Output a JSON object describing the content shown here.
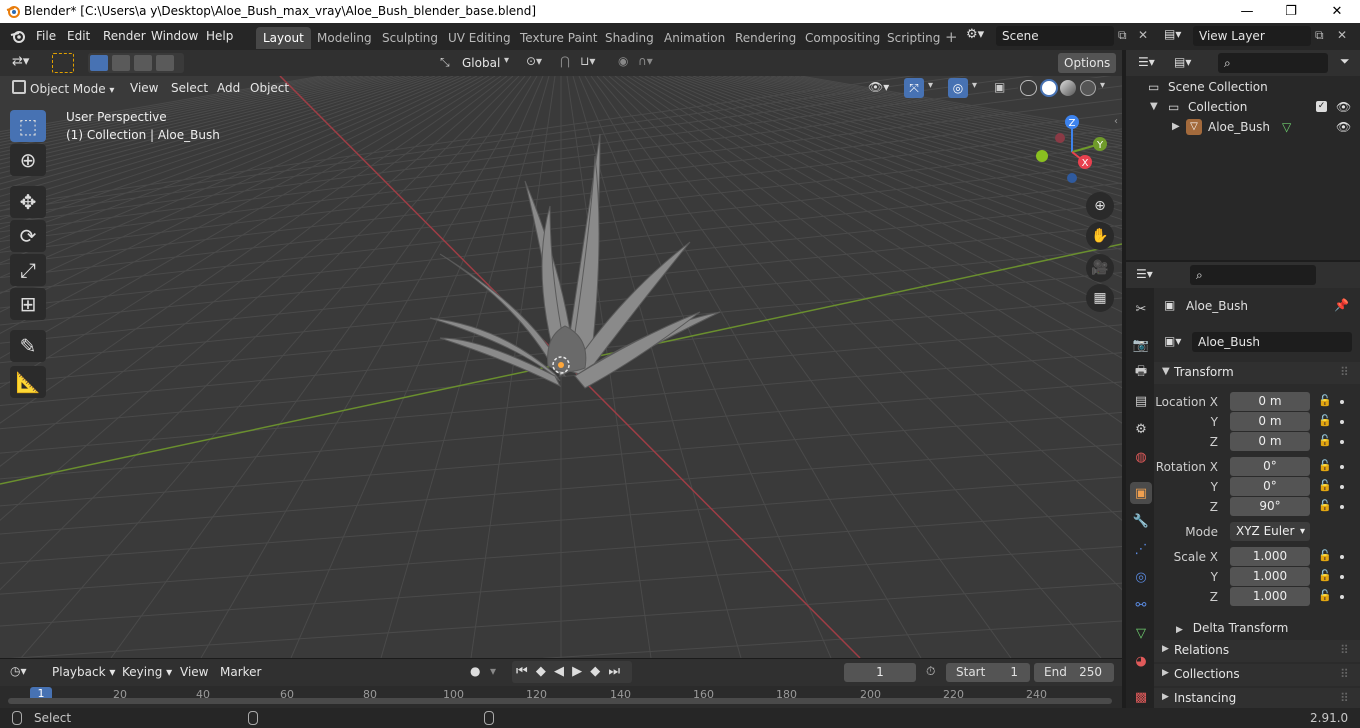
{
  "window": {
    "title": "Blender* [C:\\Users\\a y\\Desktop\\Aloe_Bush_max_vray\\Aloe_Bush_blender_base.blend]",
    "minimize": "—",
    "maximize": "❐",
    "close": "✕"
  },
  "menu": [
    "File",
    "Edit",
    "Render",
    "Window",
    "Help"
  ],
  "workspaces": [
    "Layout",
    "Modeling",
    "Sculpting",
    "UV Editing",
    "Texture Paint",
    "Shading",
    "Animation",
    "Rendering",
    "Compositing",
    "Scripting"
  ],
  "active_workspace": "Layout",
  "scene": {
    "name": "Scene"
  },
  "view_layer": {
    "name": "View Layer"
  },
  "tool_header": {
    "orientation": "Global",
    "options": "Options"
  },
  "viewport_header": {
    "mode": "Object Mode",
    "menus": [
      "View",
      "Select",
      "Add",
      "Object"
    ]
  },
  "viewport": {
    "perspective": "User Perspective",
    "collection_info": "(1) Collection | Aloe_Bush",
    "gizmo": {
      "x": "X",
      "y": "Y",
      "z": "Z"
    }
  },
  "timeline": {
    "menus": [
      "Playback",
      "Keying",
      "View",
      "Marker"
    ],
    "current_frame": "1",
    "start_label": "Start",
    "start": "1",
    "end_label": "End",
    "end": "250",
    "ticks": [
      "1",
      "20",
      "40",
      "60",
      "80",
      "100",
      "120",
      "140",
      "160",
      "180",
      "200",
      "220",
      "240"
    ]
  },
  "status": {
    "left": "Select",
    "version": "2.91.0"
  },
  "outliner": {
    "scene_collection": "Scene Collection",
    "collection": "Collection",
    "object": "Aloe_Bush"
  },
  "properties": {
    "object_name": "Aloe_Bush",
    "data_name": "Aloe_Bush",
    "transform": {
      "title": "Transform",
      "location_label": "Location X",
      "rotation_label": "Rotation X",
      "scale_label": "Scale X",
      "y_label": "Y",
      "z_label": "Z",
      "location": [
        "0 m",
        "0 m",
        "0 m"
      ],
      "rotation": [
        "0°",
        "0°",
        "90°"
      ],
      "mode_label": "Mode",
      "mode": "XYZ Euler",
      "scale": [
        "1.000",
        "1.000",
        "1.000"
      ]
    },
    "sections": [
      "Delta Transform",
      "Relations",
      "Collections",
      "Instancing"
    ]
  },
  "colors": {
    "accent": "#4772b3",
    "x_axis": "#9e3d45",
    "y_axis": "#6a8f2e",
    "gizmo_x": "#e8414f",
    "gizmo_y": "#6f9b2a",
    "gizmo_z": "#3d83ee"
  }
}
